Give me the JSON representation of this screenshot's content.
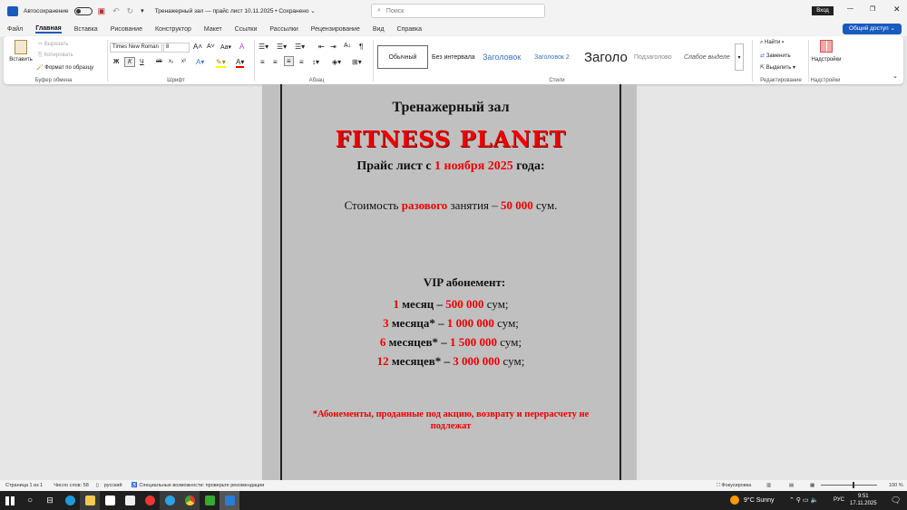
{
  "titlebar": {
    "autosave": "Автосохранение",
    "doc_title": "Тренажерный зал — прайс лист 10.11.2025 • Сохранено ⌄",
    "search_placeholder": "Поиск",
    "signin": "Вход",
    "share": "Общий доступ ⌄"
  },
  "tabs": [
    "Файл",
    "Главная",
    "Вставка",
    "Рисование",
    "Конструктор",
    "Макет",
    "Ссылки",
    "Рассылки",
    "Рецензирование",
    "Вид",
    "Справка"
  ],
  "ribbon": {
    "clipboard": {
      "paste": "Вставить",
      "cut": "Вырезать",
      "copy": "Копировать",
      "format_painter": "Формат по образцу",
      "label": "Буфер обмена"
    },
    "font": {
      "name": "Times New Roman",
      "size": "8",
      "label": "Шрифт",
      "bold": "Ж",
      "italic": "К",
      "underline": "Ч",
      "strike": "ab",
      "sub": "x₂",
      "sup": "x²"
    },
    "paragraph": {
      "label": "Абзац"
    },
    "styles": {
      "items": [
        "Обычный",
        "Без интервала",
        "Заголовок",
        "Заголовок 2",
        "Заголо",
        "Подзаголово",
        "Слабое выделе"
      ],
      "label": "Стили"
    },
    "editing": {
      "find": "Найти",
      "replace": "Заменить",
      "select": "Выделить",
      "label": "Редактирование"
    },
    "addins": {
      "button": "Надстройки",
      "label": "Надстройки"
    }
  },
  "doc": {
    "heading": "Тренажерный зал",
    "brand": "FITNESS PLANET",
    "price_pre": "Прайс лист с ",
    "price_date": "1 ноября 2025",
    "price_post": " года:",
    "single_pre": "Стоимость ",
    "single_red": "разового",
    "single_mid": " занятия – ",
    "single_price": "50 000",
    "single_post": " сум.",
    "vip": "VIP абонемент:",
    "rows": [
      {
        "n": "1",
        "unit": " месяц – ",
        "price": "500 000",
        "cur": " сум;"
      },
      {
        "n": "3",
        "unit": " месяца* – ",
        "price": "1 000 000",
        "cur": " сум;"
      },
      {
        "n": "6",
        "unit": " месяцев* – ",
        "price": "1 500 000",
        "cur": " сум;"
      },
      {
        "n": "12",
        "unit": " месяцев* – ",
        "price": "3 000 000",
        "cur": " сум;"
      }
    ],
    "note": "*Абонементы, проданные под акцию, возврату и перерасчету не подлежат"
  },
  "status": {
    "page": "Страница 1 из 1",
    "words": "Число слов: 58",
    "lang": "русский",
    "access": "Специальные возможности: проверьте рекомендации",
    "focus": "Фокусировка",
    "zoom": "100 %"
  },
  "taskbar": {
    "weather": "9°C  Sunny",
    "lang": "РУС",
    "time": "9:51",
    "date": "17.11.2025"
  }
}
